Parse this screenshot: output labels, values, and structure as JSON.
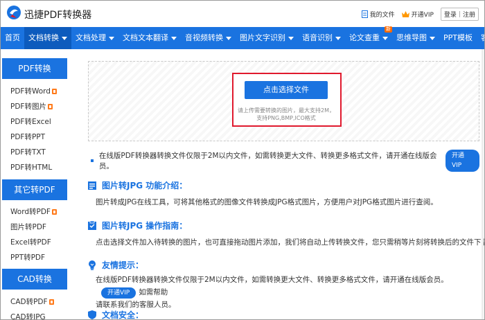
{
  "header": {
    "brand": "迅捷PDF转换器",
    "my_files": "我的文件",
    "open_vip": "开通VIP",
    "login": "登录",
    "register": "注册"
  },
  "nav": {
    "items": [
      {
        "label": "首页",
        "caret": false
      },
      {
        "label": "文档转换",
        "caret": true,
        "active": true
      },
      {
        "label": "文档处理",
        "caret": true
      },
      {
        "label": "文档文本翻译",
        "caret": true
      },
      {
        "label": "音视频转换",
        "caret": true
      },
      {
        "label": "图片文字识别",
        "caret": true
      },
      {
        "label": "语音识别",
        "caret": true
      },
      {
        "label": "论文查重",
        "caret": true,
        "badge": "新"
      },
      {
        "label": "思维导图",
        "caret": true
      },
      {
        "label": "PPT模板",
        "caret": false
      },
      {
        "label": "客户端",
        "caret": true
      }
    ]
  },
  "sidebar": {
    "groups": [
      {
        "title": "PDF转换",
        "items": [
          "PDF转Word",
          "PDF转图片",
          "PDF转Excel",
          "PDF转PPT",
          "PDF转TXT",
          "PDF转HTML"
        ]
      },
      {
        "title": "其它转PDF",
        "items": [
          "Word转PDF",
          "图片转PDF",
          "Excel转PDF",
          "PPT转PDF"
        ]
      },
      {
        "title": "CAD转换",
        "items": [
          "CAD转PDF",
          "CAD转JPG"
        ]
      }
    ]
  },
  "upload": {
    "button": "点击选择文件",
    "hint_line1": "请上传需要转换的图片，最大支持2M，",
    "hint_line2": "支持PNG,BMP,ICO格式"
  },
  "notice": {
    "text": "在线版PDF转换器转换文件仅限于2M以内文件，如需转换更大文件、转换更多格式文件，请开通在线版会员。",
    "vip_button": "开通VIP"
  },
  "sections": {
    "intro_title": "图片转JPG 功能介绍：",
    "intro_text": "图片转成JPG在线工具，可将其他格式的图像文件转换成JPG格式图片，方便用户对JPG格式图片进行查阅。",
    "guide_title": "图片转JPG 操作指南：",
    "guide_text": "点击选择文件加入待转换的图片，也可直接拖动图片添加，我们将自动上传转换文件，您只需稍等片刻将转换后的文件下载即可。",
    "tips_title": "友情提示：",
    "tips_text_a": "在线版PDF转换器转换文件仅限于2M以内文件，如需转换更大文件、转换更多格式文件，请开通在线版会员。",
    "tips_vip": "开通VIP",
    "tips_text_b": "如需帮助",
    "tips_text_c": "请联系我们的客服人员。",
    "security_title": "文档安全："
  }
}
